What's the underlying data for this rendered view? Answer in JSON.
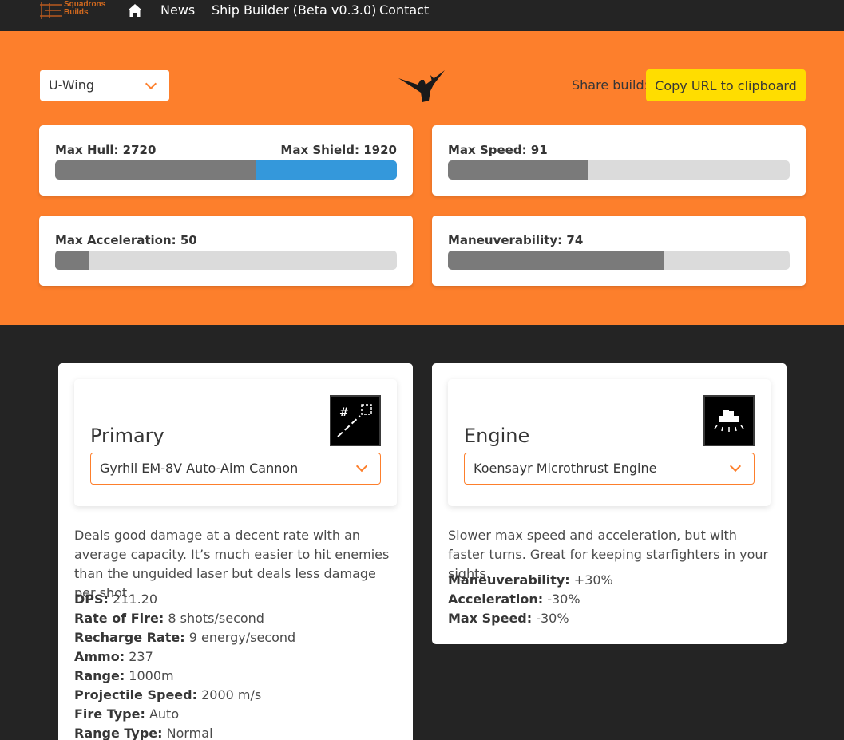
{
  "nav": {
    "brand_line1": "Squadrons",
    "brand_line2": "Builds",
    "home_icon": "home-icon",
    "links": [
      "News",
      "Ship Builder (Beta v0.3.0)",
      "Contact"
    ]
  },
  "ship": {
    "selected": "U-Wing",
    "icon": "u-wing-silhouette-icon"
  },
  "share": {
    "label": "Share build:",
    "button": "Copy URL to clipboard"
  },
  "stats": {
    "hull_label": "Max Hull: 2720",
    "shield_label": "Max Shield: 1920",
    "hull_value": 2720,
    "shield_value": 1920,
    "speed_label": "Max Speed: 91",
    "speed_fraction": 0.41,
    "accel_label": "Max Acceleration: 50",
    "accel_fraction": 0.1,
    "maneuver_label": "Maneuverability: 74",
    "maneuver_fraction": 0.63
  },
  "primary": {
    "title": "Primary",
    "icon": "auto-aim-cannon-icon",
    "selected": "Gyrhil EM-8V Auto-Aim Cannon",
    "description": "Deals good damage at a decent rate with an average capacity. It’s much easier to hit enemies than the unguided laser but deals less damage per shot.",
    "stats": [
      {
        "k": "DPS:",
        "v": "211.20"
      },
      {
        "k": "Rate of Fire:",
        "v": "8 shots/second"
      },
      {
        "k": "Recharge Rate:",
        "v": "9 energy/second"
      },
      {
        "k": "Ammo:",
        "v": "237"
      },
      {
        "k": "Range:",
        "v": "1000m"
      },
      {
        "k": "Projectile Speed:",
        "v": "2000 m/s"
      },
      {
        "k": "Fire Type:",
        "v": "Auto"
      },
      {
        "k": "Range Type:",
        "v": "Normal"
      }
    ]
  },
  "engine": {
    "title": "Engine",
    "icon": "microthrust-engine-icon",
    "selected": "Koensayr Microthrust Engine",
    "description": "Slower max speed and acceleration, but with faster turns. Great for keeping starfighters in your sights.",
    "stats": [
      {
        "k": "Maneuverability:",
        "v": "+30%"
      },
      {
        "k": "Acceleration:",
        "v": "-30%"
      },
      {
        "k": "Max Speed:",
        "v": "-30%"
      }
    ]
  }
}
